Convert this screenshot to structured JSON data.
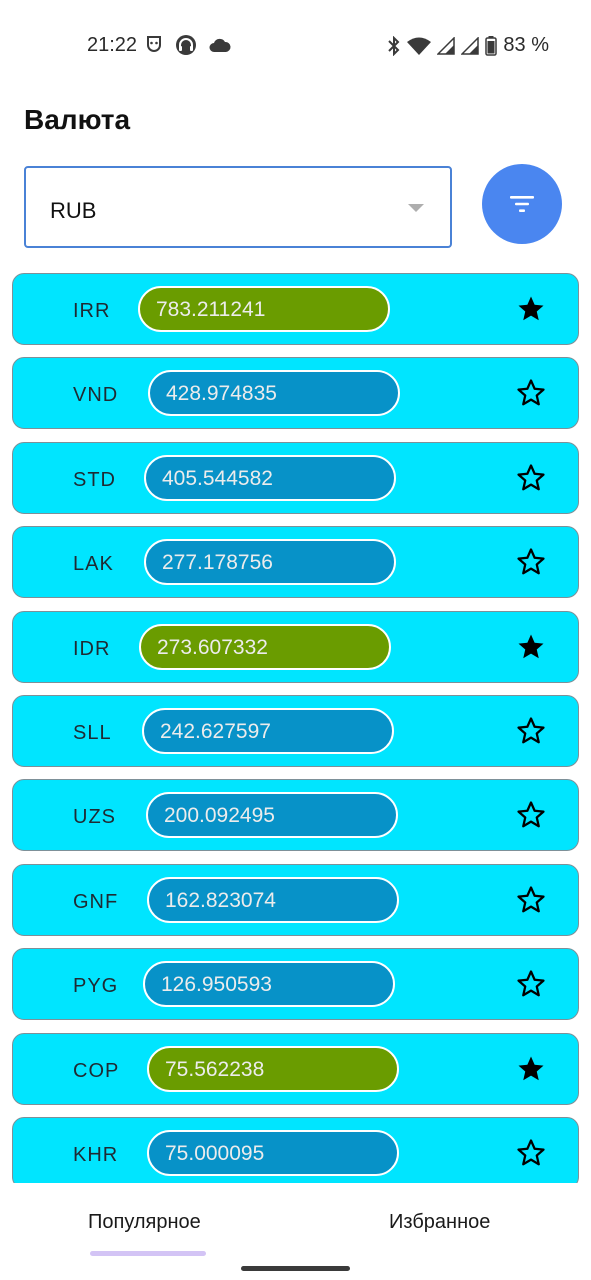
{
  "status_bar": {
    "time": "21:22",
    "battery": "83 %",
    "left_icons": [
      "mask-icon",
      "headset-icon",
      "cloud-icon"
    ],
    "right_icons": [
      "bluetooth-icon",
      "wifi-icon",
      "signal-icon",
      "signal-icon",
      "battery-icon"
    ]
  },
  "page": {
    "title": "Валюта"
  },
  "currency_select": {
    "value": "RUB"
  },
  "filter_button": {
    "icon": "filter-icon",
    "color": "#4a86f0"
  },
  "colors": {
    "row_background": "#00e5ff",
    "pill_default": "#0792c8",
    "pill_favorite": "#6a9c00"
  },
  "rates": [
    {
      "code": "IRR",
      "value": "783.211241",
      "favorite": true
    },
    {
      "code": "VND",
      "value": "428.974835",
      "favorite": false
    },
    {
      "code": "STD",
      "value": "405.544582",
      "favorite": false
    },
    {
      "code": "LAK",
      "value": "277.178756",
      "favorite": false
    },
    {
      "code": "IDR",
      "value": "273.607332",
      "favorite": true
    },
    {
      "code": "SLL",
      "value": "242.627597",
      "favorite": false
    },
    {
      "code": "UZS",
      "value": "200.092495",
      "favorite": false
    },
    {
      "code": "GNF",
      "value": "162.823074",
      "favorite": false
    },
    {
      "code": "PYG",
      "value": "126.950593",
      "favorite": false
    },
    {
      "code": "COP",
      "value": "75.562238",
      "favorite": true
    },
    {
      "code": "KHR",
      "value": "75.000095",
      "favorite": false
    }
  ],
  "tabs": [
    {
      "label": "Популярное",
      "active": true
    },
    {
      "label": "Избранное",
      "active": false
    }
  ]
}
